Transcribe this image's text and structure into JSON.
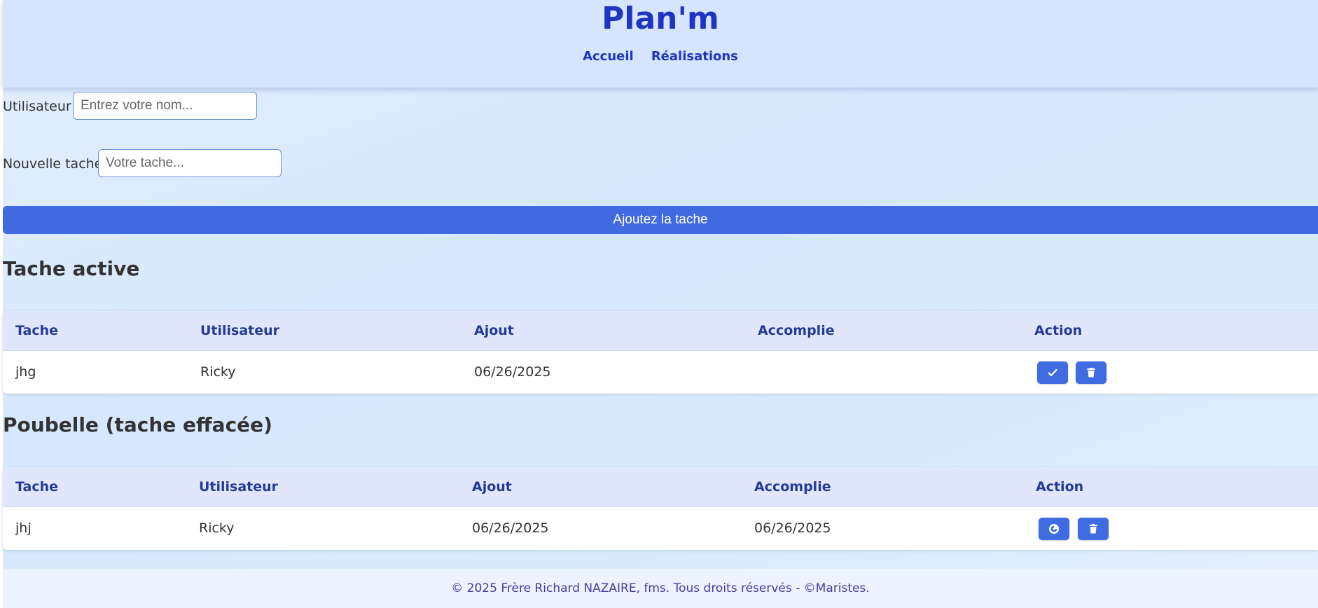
{
  "header": {
    "title": "Plan'm",
    "nav": [
      {
        "label": "Accueil"
      },
      {
        "label": "Réalisations"
      }
    ]
  },
  "form": {
    "user_label": "Utilisateur :",
    "user_placeholder": "Entrez votre nom...",
    "user_value": "",
    "task_label": "Nouvelle tache:",
    "task_placeholder": "Votre tache...",
    "task_value": "",
    "submit_label": "Ajoutez la tache"
  },
  "active": {
    "title": "Tache active",
    "columns": [
      "Tache",
      "Utilisateur",
      "Ajout",
      "Accomplie",
      "Action"
    ],
    "rows": [
      {
        "task": "jhg",
        "user": "Ricky",
        "added": "06/26/2025",
        "done": "",
        "actions": [
          "check-icon",
          "trash-icon"
        ]
      }
    ]
  },
  "trash": {
    "title": "Poubelle (tache effacée)",
    "columns": [
      "Tache",
      "Utilisateur",
      "Ajout",
      "Accomplie",
      "Action"
    ],
    "rows": [
      {
        "task": "jhj",
        "user": "Ricky",
        "added": "06/26/2025",
        "done": "06/26/2025",
        "actions": [
          "restore-icon",
          "trash-icon"
        ]
      }
    ]
  },
  "footer": {
    "text": "© 2025 Frère Richard NAZAIRE, fms. Tous droits réservés - ©Maristes."
  },
  "colors": {
    "accent": "#4169e1",
    "brand": "#2233c4",
    "header_bg": "#d4e5fd",
    "table_head_bg": "#e0e7fd"
  }
}
